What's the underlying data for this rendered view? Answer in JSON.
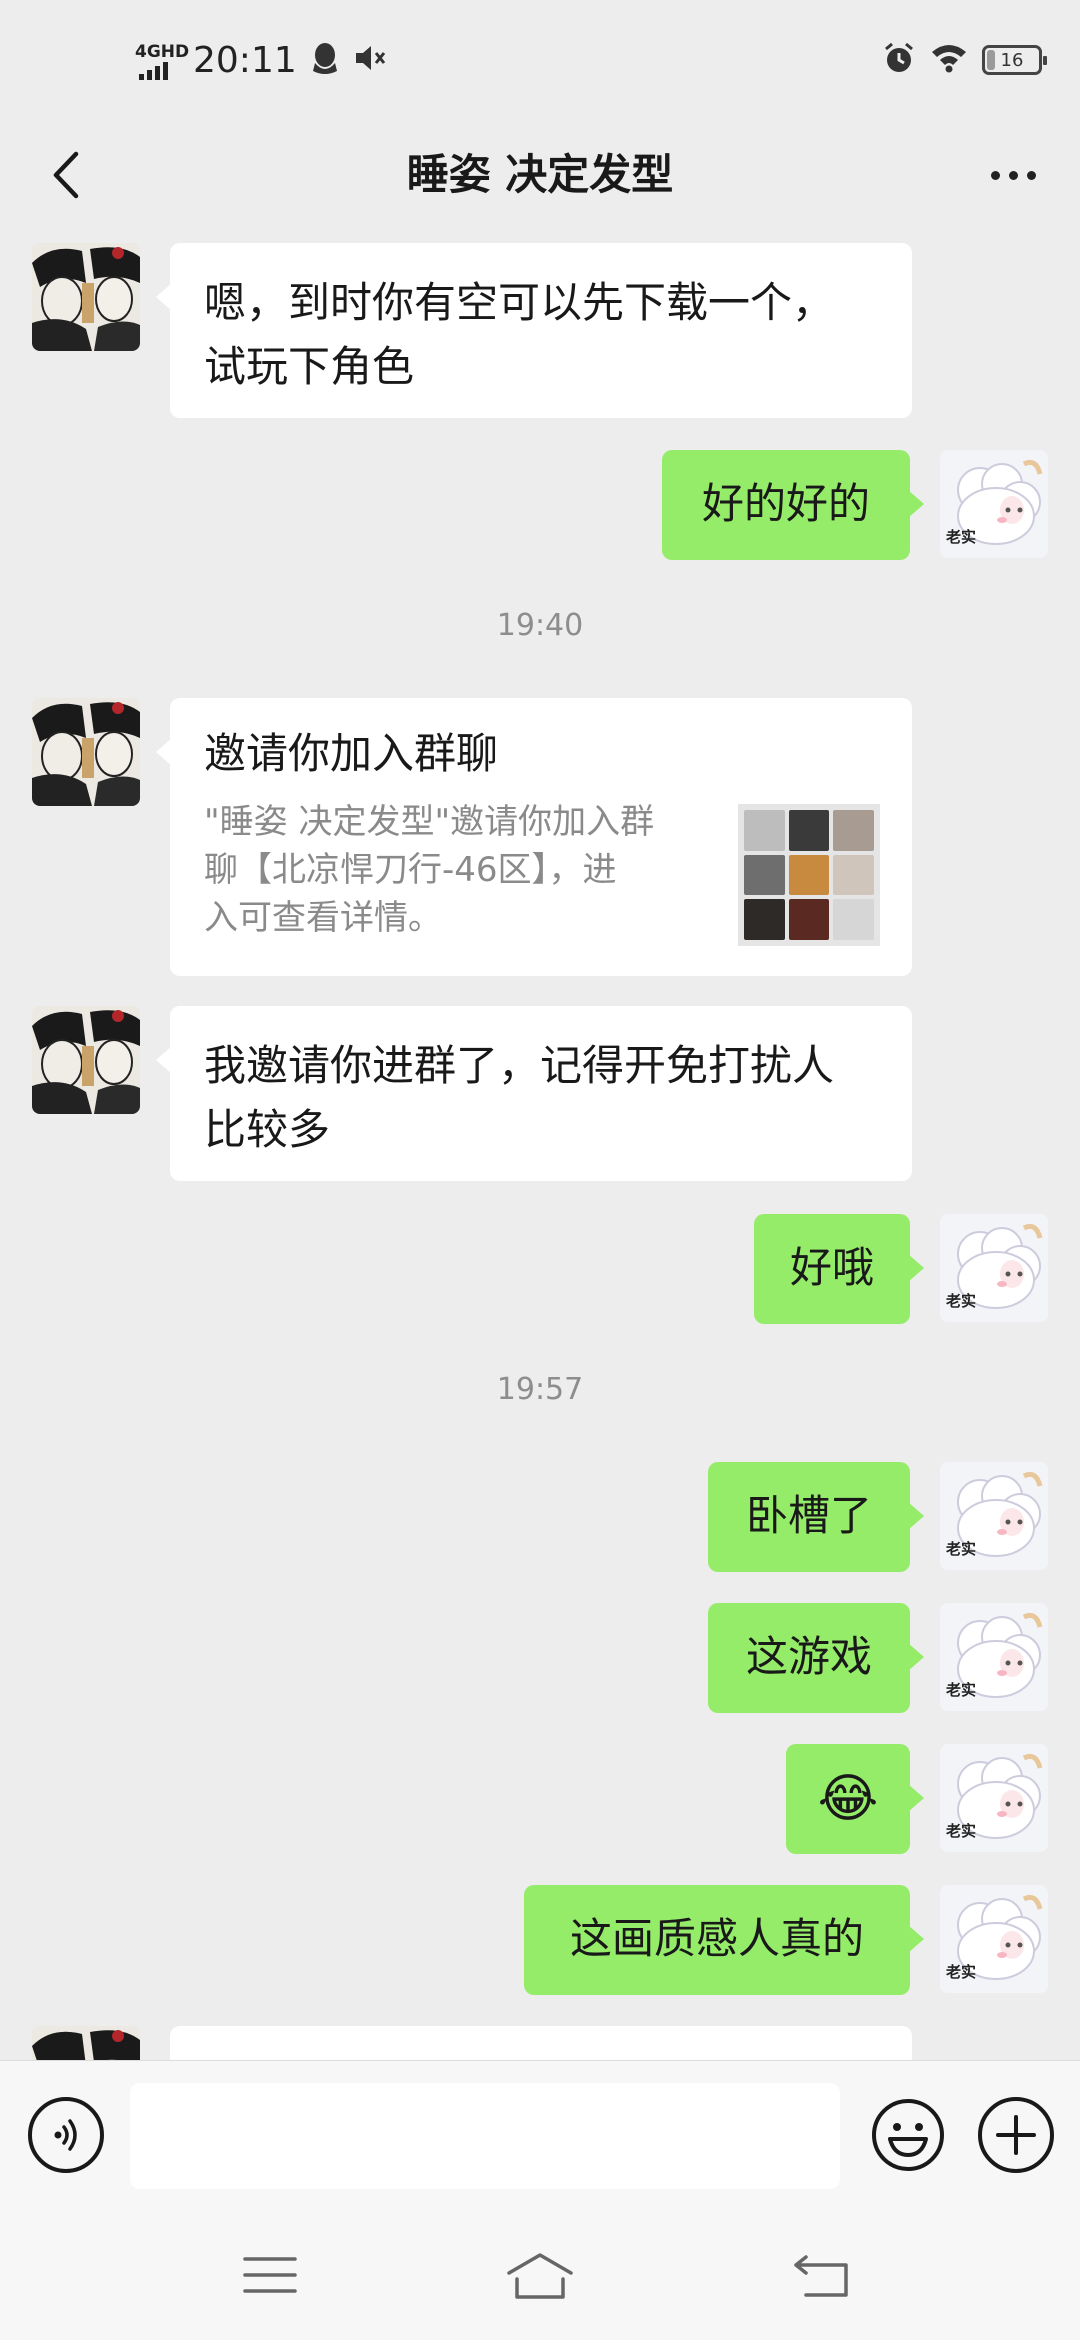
{
  "status_bar": {
    "network": "4GHD",
    "time": "20:11",
    "battery": "16",
    "battery_level": 0.16
  },
  "header": {
    "title": "睡姿 决定发型"
  },
  "messages": {
    "m1": {
      "text_line1": "嗯，到时你有空可以先下载一个，",
      "text_line2": "试玩下角色"
    },
    "m2": {
      "text": "好的好的"
    },
    "t1": "19:40",
    "m3": {
      "card_title": "邀请你加入群聊",
      "card_desc_line1": "\"睡姿 决定发型\"邀请你加入群",
      "card_desc_line2": "聊【北凉悍刀行-46区】，进",
      "card_desc_line3": "入可查看详情。"
    },
    "m4": {
      "text_line1": "我邀请你进群了，记得开免打扰人",
      "text_line2": "比较多"
    },
    "m5": {
      "text": "好哦"
    },
    "t2": "19:57",
    "m6": {
      "text": "卧槽了"
    },
    "m7": {
      "text": "这游戏"
    },
    "m8": {
      "emoji": "😂"
    },
    "m9": {
      "text": "这画质感人真的"
    }
  },
  "self_avatar_caption": "老实",
  "colors": {
    "background": "#ededed",
    "sent_bubble": "#95ec69",
    "received_bubble": "#ffffff",
    "timestamp": "#8d8d8d"
  },
  "icons": [
    "back-icon",
    "more-icon",
    "voice-icon",
    "emoji-icon",
    "plus-icon",
    "menu-icon",
    "home-icon",
    "return-icon",
    "alarm-icon",
    "wifi-icon",
    "qq-icon",
    "mute-icon"
  ]
}
